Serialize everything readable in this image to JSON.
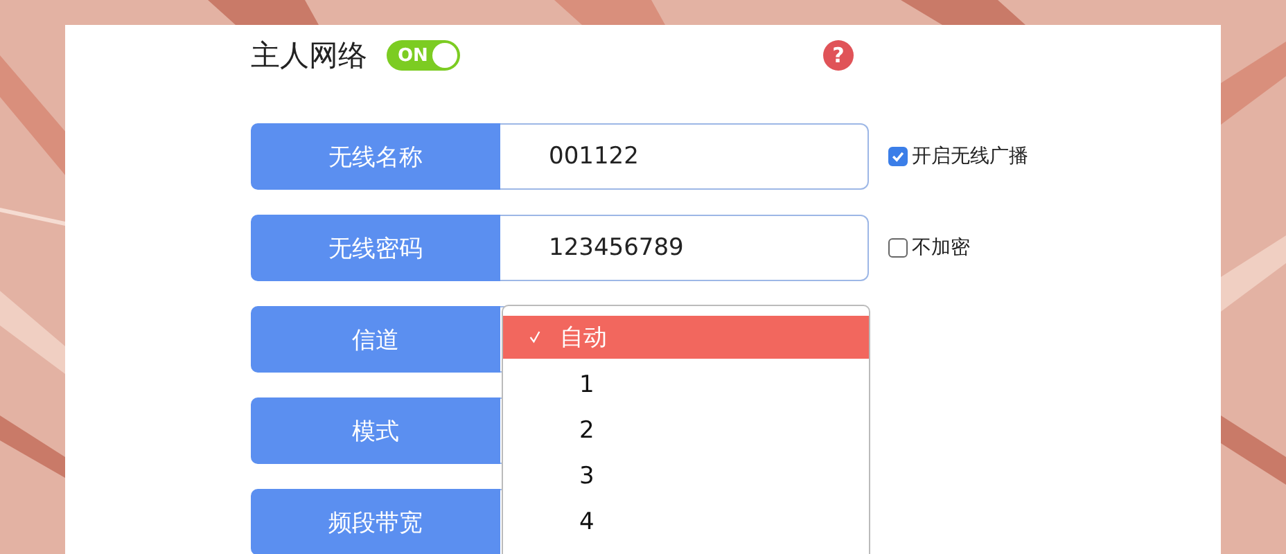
{
  "header": {
    "title": "主人网络",
    "toggle": {
      "label": "ON",
      "on": true
    },
    "help": {
      "glyph": "?"
    }
  },
  "rows": [
    {
      "label": "无线名称",
      "kind": "text",
      "value": "001122",
      "option": {
        "label": "开启无线广播",
        "checked": true
      }
    },
    {
      "label": "无线密码",
      "kind": "text",
      "value": "123456789",
      "option": {
        "label": "不加密",
        "checked": false
      }
    },
    {
      "label": "信道",
      "kind": "select"
    },
    {
      "label": "模式",
      "kind": "select"
    },
    {
      "label": "频段带宽",
      "kind": "select"
    }
  ],
  "dropdown": {
    "options": [
      {
        "label": "自动",
        "selected": true
      },
      {
        "label": "1",
        "selected": false
      },
      {
        "label": "2",
        "selected": false
      },
      {
        "label": "3",
        "selected": false
      },
      {
        "label": "4",
        "selected": false
      }
    ]
  }
}
